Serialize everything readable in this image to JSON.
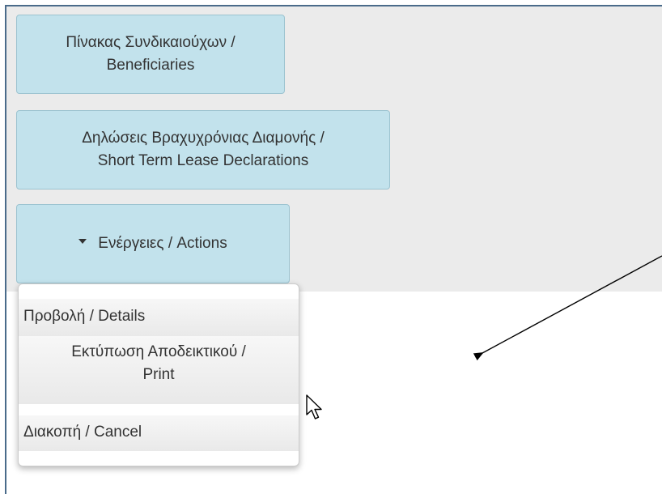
{
  "toolbar": {
    "beneficiaries_line1": "Πίνακας Συνδικαιούχων /",
    "beneficiaries_line2": "Beneficiaries",
    "declarations_line1": "Δηλώσεις Βραχυχρόνιας Διαμονής /",
    "declarations_line2": "Short Term Lease Declarations",
    "actions_label": "Ενέργειες /  Actions"
  },
  "dropdown": {
    "items": [
      {
        "label": "Προβολή / Details"
      },
      {
        "label_line1": "Εκτύπωση Αποδεικτικού /",
        "label_line2": "Print"
      },
      {
        "label": "Διακοπή /  Cancel"
      }
    ]
  },
  "annotation": {
    "arrow_color": "#000000"
  },
  "colors": {
    "button_bg": "#c2e2ec",
    "panel_bg": "#ebebeb",
    "text": "#333333"
  },
  "icons": {
    "dropdown_caret": "caret-down-icon",
    "cursor": "mouse-pointer-icon"
  }
}
